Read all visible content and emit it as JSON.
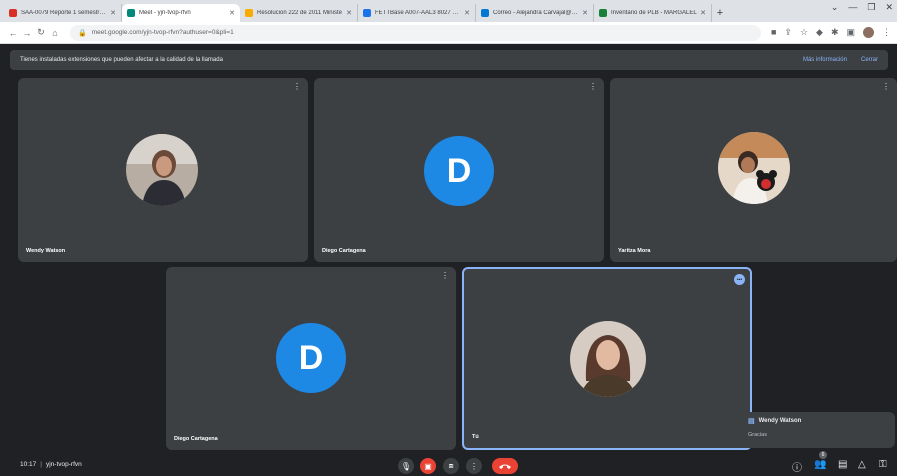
{
  "browser": {
    "tabs": [
      {
        "label": "SAA-0079 Reporte 1 semestre 2",
        "color": "#d93025",
        "active": false
      },
      {
        "label": "Meet - yjn-tvop-rfvn",
        "color": "#00897b",
        "active": true
      },
      {
        "label": "Resolucion 222 de 2011 Ministe",
        "color": "#f9ab00",
        "active": false
      },
      {
        "label": "FETTBase A007-AAL3 8027 aBG",
        "color": "#1a73e8",
        "active": false
      },
      {
        "label": "Correo - Alejandra Carvajal@cor",
        "color": "#0078d4",
        "active": false
      },
      {
        "label": "Inventario de PLB - MARGALEL",
        "color": "#188038",
        "active": false
      }
    ],
    "url": "meet.google.com/yjn-tvop-rfvn?authuser=0&pli=1"
  },
  "banner": {
    "message": "Tienes instaladas extensiones que pueden afectar a la calidad de la llamada",
    "more_info": "Más información",
    "close": "Cerrar"
  },
  "participants": [
    {
      "name": "Wendy Watson",
      "kind": "photo",
      "bg": "#b0a090"
    },
    {
      "name": "Diego Cartagena",
      "kind": "letter",
      "initial": "D"
    },
    {
      "name": "Yaritza Mora",
      "kind": "photo",
      "bg": "#c0a080"
    },
    {
      "name": "Diego Cartagena",
      "kind": "letter",
      "initial": "D"
    },
    {
      "name": "Tú",
      "kind": "photo",
      "bg": "#a08070"
    }
  ],
  "chat_toast": {
    "sender": "Wendy Watson",
    "message": "Gracias"
  },
  "meeting": {
    "time": "10:17",
    "separator": "|",
    "code": "yjn-tvop-rfvn",
    "participant_count": "6"
  },
  "colors": {
    "tile_bg": "#3c4043",
    "accent": "#8ab4f8",
    "avatar_blue": "#1e88e5",
    "end_call": "#ea4335"
  }
}
